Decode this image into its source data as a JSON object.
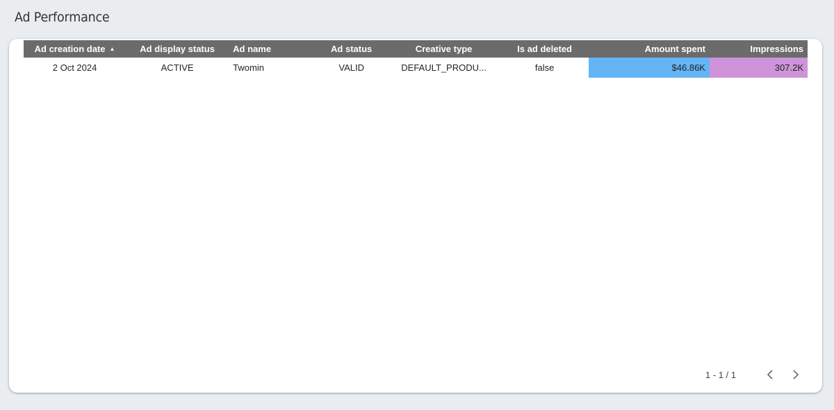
{
  "page": {
    "title": "Ad Performance"
  },
  "table": {
    "headers": {
      "ad_creation_date": "Ad creation date",
      "ad_display_status": "Ad display status",
      "ad_name": "Ad name",
      "ad_status": "Ad status",
      "creative_type": "Creative type",
      "is_ad_deleted": "Is ad deleted",
      "amount_spent": "Amount spent",
      "impressions": "Impressions"
    },
    "sort": {
      "column": "Ad creation date",
      "direction": "ascending",
      "icon": "sort-ascending-icon"
    },
    "rows": [
      {
        "ad_creation_date": "2 Oct 2024",
        "ad_display_status": "ACTIVE",
        "ad_name": "Twomin",
        "ad_status": "VALID",
        "creative_type": "DEFAULT_PRODU...",
        "is_ad_deleted": "false",
        "amount_spent": "$46.86K",
        "impressions": "307.2K"
      }
    ]
  },
  "colors": {
    "header_bg": "#6b6b6b",
    "amount_spent_bar": "#64b5f6",
    "impressions_bar": "#ce93d8",
    "page_bg": "#e9edf0"
  },
  "pagination": {
    "label": "1 - 1 / 1",
    "prev_icon": "chevron-left-icon",
    "next_icon": "chevron-right-icon"
  }
}
